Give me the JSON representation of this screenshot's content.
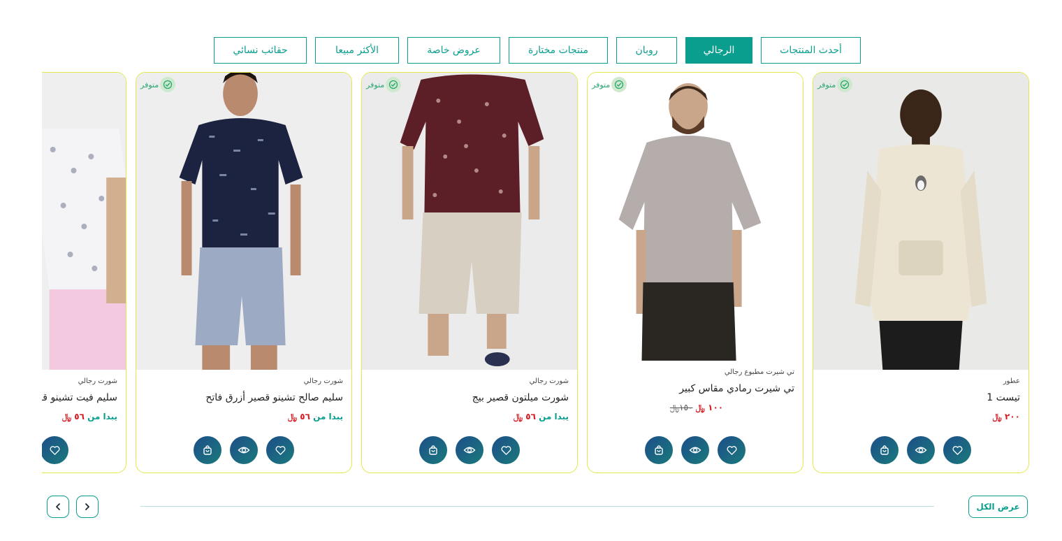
{
  "tabs": [
    {
      "label": "أحدث المنتجات",
      "active": false
    },
    {
      "label": "الرجالي",
      "active": true
    },
    {
      "label": "روبان",
      "active": false
    },
    {
      "label": "منتجات مختارة",
      "active": false
    },
    {
      "label": "عروض خاصة",
      "active": false
    },
    {
      "label": "الأكثر مبيعا",
      "active": false
    },
    {
      "label": "حقائب نسائي",
      "active": false
    }
  ],
  "products": [
    {
      "badge": "متوفر",
      "category": "عطور",
      "name": "تيست 1",
      "price": "٢٠٠",
      "price_prefix": "",
      "old_price": ""
    },
    {
      "badge": "متوفر",
      "category": "تي شيرت مطبوع رجالي",
      "name": "تي شيرت رمادي مقاس كبير",
      "price": "١٠٠",
      "price_prefix": "",
      "old_price": "١٥٠"
    },
    {
      "badge": "متوفر",
      "category": "شورت رجالي",
      "name": "شورت ميلتون قصير بيج",
      "price": "٥٦",
      "price_prefix": "يبدا من",
      "old_price": ""
    },
    {
      "badge": "متوفر",
      "category": "شورت رجالي",
      "name": "سليم صالح تشينو قصير أزرق فاتح",
      "price": "٥٦",
      "price_prefix": "يبدا من",
      "old_price": ""
    },
    {
      "badge": "",
      "category": "شورت رجالي",
      "name": "سليم فيت تشينو قصير",
      "price": "٥٦",
      "price_prefix": "يبدا من",
      "old_price": ""
    }
  ],
  "currency_symbol": "﷼",
  "view_all_label": "عرض الكل",
  "icons": {
    "wishlist": "heart-icon",
    "quick_view": "eye-icon",
    "cart": "cart-icon",
    "badge": "check-circle-icon",
    "prev": "chevron-left-icon",
    "next": "chevron-right-icon"
  },
  "colors": {
    "accent": "#0a9e8e",
    "card_border": "#e4e84a",
    "price_red": "#d71920",
    "button_gradient_start": "#1d4e89",
    "button_gradient_end": "#1a7a7b"
  }
}
